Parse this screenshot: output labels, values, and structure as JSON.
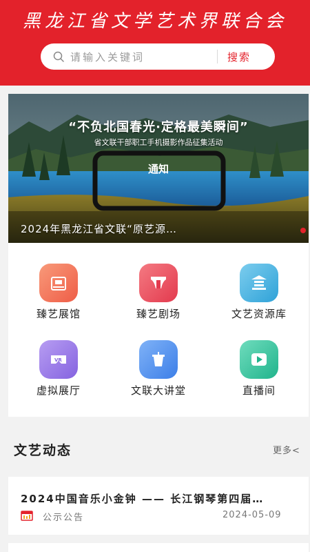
{
  "header": {
    "app_title": "黑龙江省文学艺术界联合会",
    "search_placeholder": "请输入关键词",
    "search_button": "搜索",
    "brand_color": "#e3222b"
  },
  "banner": {
    "headline": "“不负北国春光·定格最美瞬间”",
    "subtitle": "省文联干部职工手机摄影作品征集活动",
    "phone_text": "通知",
    "caption": "2024年黑龙江省文联“原艺源…"
  },
  "features": [
    {
      "label": "臻艺展馆",
      "icon": "museum-icon",
      "color": "#f4735a"
    },
    {
      "label": "臻艺剧场",
      "icon": "theater-icon",
      "color": "#ea4a5c"
    },
    {
      "label": "文艺资源库",
      "icon": "library-icon",
      "color": "#3fb3e2"
    },
    {
      "label": "虚拟展厅",
      "icon": "vr-icon",
      "color": "#9b7ae8"
    },
    {
      "label": "文联大讲堂",
      "icon": "lecture-icon",
      "color": "#4a8ff0"
    },
    {
      "label": "直播间",
      "icon": "live-icon",
      "color": "#36c4a0"
    }
  ],
  "news_section": {
    "title": "文艺动态",
    "more": "更多<"
  },
  "news": [
    {
      "title": "2024中国音乐小金钟 —— 长江钢琴第四届…",
      "tag": "公示公告",
      "date": "2024-05-09"
    }
  ]
}
